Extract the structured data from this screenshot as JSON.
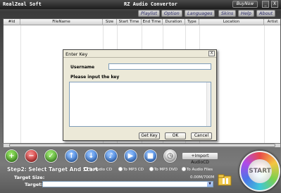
{
  "window": {
    "brand": "RealZeal Soft",
    "title": "RZ Audio Convertor",
    "buy_now": "BuyNow",
    "minimize": "_",
    "close": "X"
  },
  "menu": {
    "items": [
      "Playlist",
      "Option",
      "Languages",
      "Skins",
      "Help",
      "About"
    ]
  },
  "table": {
    "columns": [
      "#Id",
      "FileName",
      "Size",
      "Start Time",
      "End Time",
      "Duration",
      "Type",
      "Location",
      "Artist"
    ]
  },
  "dialog": {
    "title": "Enter Key",
    "close": "X",
    "username_label": "Username",
    "username_value": "",
    "key_label": "Please input the key",
    "key_value": "",
    "get_key": "Get Key",
    "ok": "OK",
    "cancel": "Cancel"
  },
  "toolbar": {
    "icons": [
      "add-icon",
      "remove-icon",
      "check-icon",
      "arrow-up-icon",
      "arrow-down-icon",
      "music-icon",
      "play-icon",
      "stop-icon",
      "clock-icon"
    ],
    "import_cd": "Import AudioCD"
  },
  "step2": {
    "heading": "Step2: Select Target And Start",
    "options": [
      "To Audio CD",
      "To MP3 CD",
      "To MP3 DVD",
      "To Audio Files"
    ],
    "selected": "To Audio CD",
    "target_size_label": "Target Size:",
    "target_size_value": "0.00M/700M",
    "target_label": "Target:",
    "target_value": ""
  },
  "start": {
    "label": "START"
  }
}
